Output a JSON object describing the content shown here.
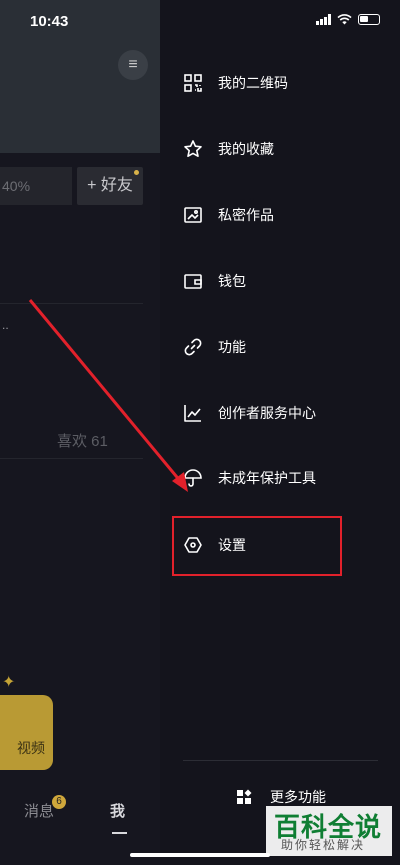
{
  "status_bar": {
    "time": "10:43"
  },
  "background": {
    "progress_text": "40%",
    "add_friend": "+ 好友",
    "likes": "喜欢 61",
    "ellipsis": "..",
    "video_label": "视频",
    "tab_messages": "消息",
    "messages_badge": "6",
    "tab_me": "我"
  },
  "drawer": {
    "items": [
      {
        "label": "我的二维码",
        "icon": "qr-code-icon"
      },
      {
        "label": "我的收藏",
        "icon": "star-icon"
      },
      {
        "label": "私密作品",
        "icon": "private-works-icon"
      },
      {
        "label": "钱包",
        "icon": "wallet-icon"
      },
      {
        "label": "功能",
        "icon": "link-icon"
      },
      {
        "label": "创作者服务中心",
        "icon": "chart-icon"
      },
      {
        "label": "未成年保护工具",
        "icon": "umbrella-icon"
      },
      {
        "label": "设置",
        "icon": "hexagon-settings-icon"
      }
    ],
    "more_label": "更多功能"
  },
  "watermark": {
    "main": "百科全说",
    "sub": "助你轻松解决"
  },
  "colors": {
    "highlight": "#e2212b",
    "drawer_bg": "#14141c",
    "watermark_green": "#0f7e33"
  }
}
